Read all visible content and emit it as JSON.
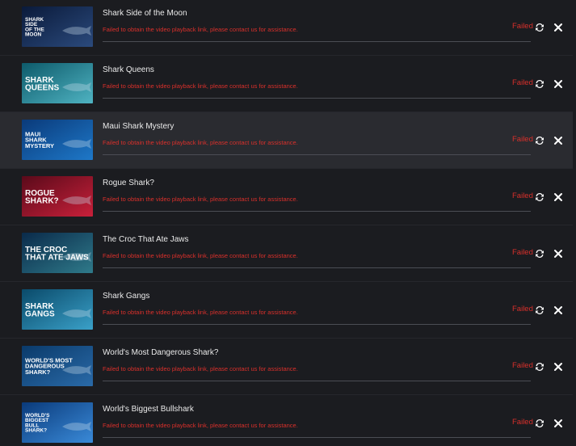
{
  "downloads": [
    {
      "title": "Shark Side of the Moon",
      "error": "Failed to obtain the video playback link, please contact us for assistance.",
      "status": "Failed",
      "thumb_text": [
        "SHARK",
        "SIDE",
        "OF THE",
        "MOON"
      ],
      "thumb_colors": [
        "#0a1a3a",
        "#2b4a7c"
      ]
    },
    {
      "title": "Shark Queens",
      "error": "Failed to obtain the video playback link, please contact us for assistance.",
      "status": "Failed",
      "thumb_text": [
        "SHARK",
        "QUEENS"
      ],
      "thumb_colors": [
        "#0d5a6a",
        "#4fb3c2"
      ]
    },
    {
      "title": "Maui Shark Mystery",
      "error": "Failed to obtain the video playback link, please contact us for assistance.",
      "status": "Failed",
      "thumb_text": [
        "MAUI",
        "SHARK",
        "MYSTERY"
      ],
      "thumb_colors": [
        "#0a3a7a",
        "#1e78c8"
      ]
    },
    {
      "title": "Rogue Shark?",
      "error": "Failed to obtain the video playback link, please contact us for assistance.",
      "status": "Failed",
      "thumb_text": [
        "ROGUE",
        "SHARK?"
      ],
      "thumb_colors": [
        "#5a0a1a",
        "#c8203a"
      ]
    },
    {
      "title": "The Croc That Ate Jaws",
      "error": "Failed to obtain the video playback link, please contact us for assistance.",
      "status": "Failed",
      "thumb_text": [
        "THE CROC",
        "THAT ATE JAWS"
      ],
      "thumb_colors": [
        "#0a2a4a",
        "#2f7a8a"
      ]
    },
    {
      "title": "Shark Gangs",
      "error": "Failed to obtain the video playback link, please contact us for assistance.",
      "status": "Failed",
      "thumb_text": [
        "SHARK",
        "GANGS"
      ],
      "thumb_colors": [
        "#0a4a6a",
        "#3aa0c8"
      ]
    },
    {
      "title": "World's Most Dangerous Shark?",
      "error": "Failed to obtain the video playback link, please contact us for assistance.",
      "status": "Failed",
      "thumb_text": [
        "WORLD'S MOST",
        "DANGEROUS",
        "SHARK?"
      ],
      "thumb_colors": [
        "#0a3a6a",
        "#2a6aa8"
      ]
    },
    {
      "title": "World's Biggest Bullshark",
      "error": "Failed to obtain the video playback link, please contact us for assistance.",
      "status": "Failed",
      "thumb_text": [
        "WORLD'S",
        "BIGGEST",
        "BULL",
        "SHARK?"
      ],
      "thumb_colors": [
        "#0a3a7a",
        "#3a8ad8"
      ]
    }
  ],
  "colors": {
    "background": "#1b1c20",
    "highlight_row": "#2a2b30",
    "error_red": "#d9302b",
    "title_text": "#eaeaea"
  },
  "icons": {
    "retry": "retry-icon",
    "close": "close-icon"
  }
}
